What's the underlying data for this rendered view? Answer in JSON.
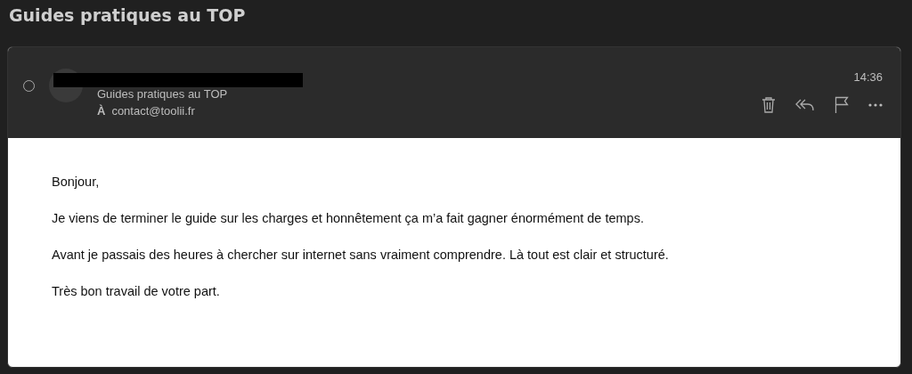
{
  "window": {
    "title": "Guides pratiques au TOP"
  },
  "message": {
    "selected": false,
    "subject": "Guides pratiques au TOP",
    "to_label": "À",
    "to": "contact@toolii.fr",
    "time": "14:36",
    "body": [
      "Bonjour,",
      "Je viens de terminer le guide sur les charges et honnêtement ça m’a fait gagner énormément de temps.",
      "Avant je passais des heures à chercher sur internet sans vraiment comprendre. Là tout est clair et structuré.",
      "Très bon travail de votre part."
    ]
  }
}
